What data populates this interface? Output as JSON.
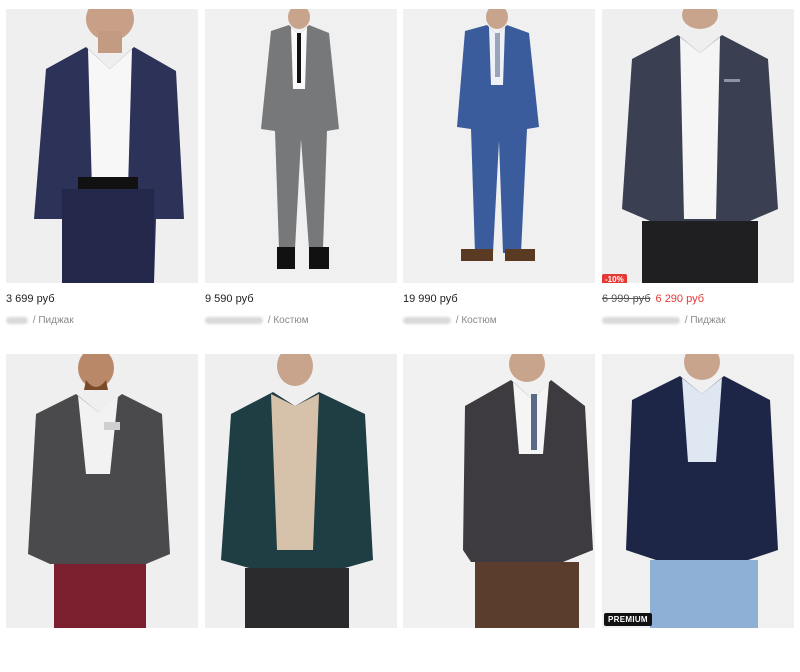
{
  "products": [
    {
      "price": "3 699 руб",
      "category": "Пиджак",
      "sep": "/"
    },
    {
      "price": "9 590 руб",
      "category": "Костюм",
      "sep": "/"
    },
    {
      "price": "19 990 руб",
      "category": "Костюм",
      "sep": "/"
    },
    {
      "old_price": "6 999 руб",
      "price": "6 290 руб",
      "category": "Пиджак",
      "sep": "/",
      "badge": "-10%"
    },
    {
      "price": "",
      "category": "",
      "sep": ""
    },
    {
      "price": "",
      "category": "",
      "sep": ""
    },
    {
      "price": "",
      "category": "",
      "sep": ""
    },
    {
      "price": "",
      "category": "",
      "sep": "",
      "badge": "PREMIUM"
    }
  ],
  "colors": {
    "sale": "#e53935",
    "photo_bg": "#f2f2f2",
    "premium_bg": "#111111"
  },
  "icons": {
    "product-image": "product-photo"
  }
}
